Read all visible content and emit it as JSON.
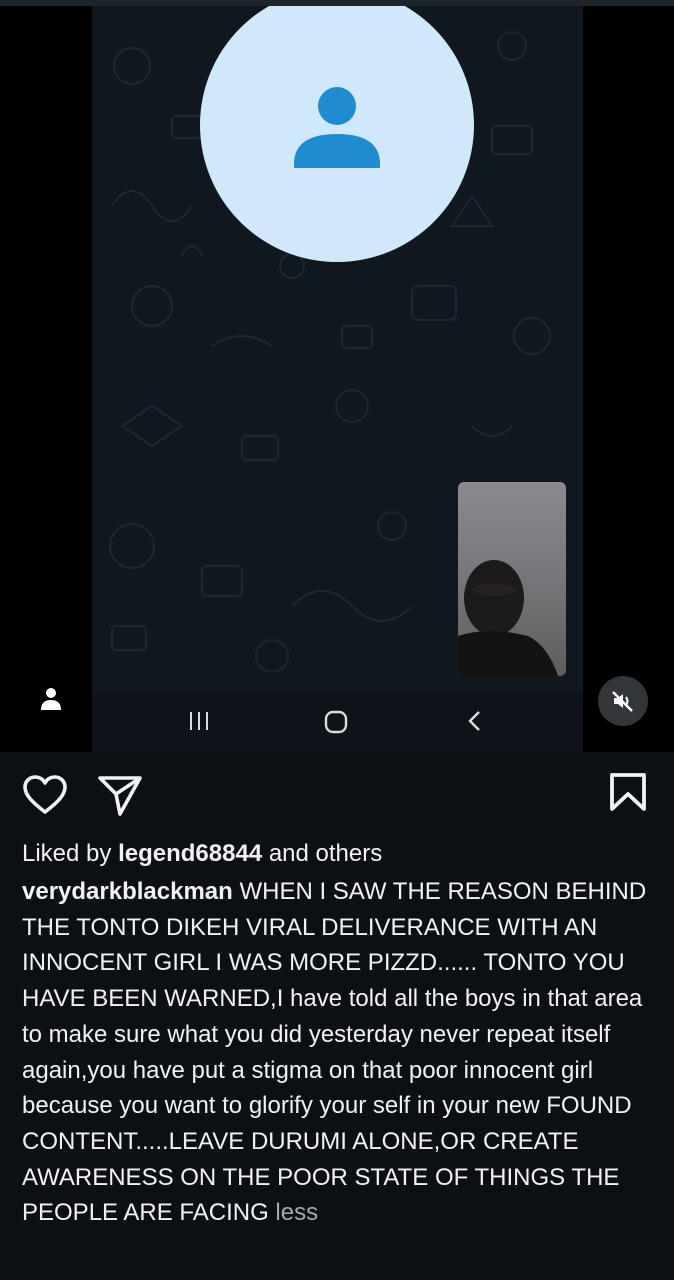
{
  "video": {
    "remote_avatar_icon": "person-icon",
    "self_view_label": "self-view camera preview",
    "nav_buttons": [
      "recent-apps-icon",
      "home-icon",
      "back-icon"
    ],
    "user_tag_icon": "person-icon",
    "mute_icon": "speaker-muted-icon"
  },
  "post": {
    "actions": {
      "like_icon": "heart-icon",
      "share_icon": "send-icon",
      "save_icon": "bookmark-icon"
    },
    "likes": {
      "prefix": "Liked by ",
      "user": "legend68844",
      "suffix": " and others"
    },
    "caption": {
      "username": "verydarkblackman",
      "text": " WHEN I SAW THE REASON BEHIND THE TONTO DIKEH VIRAL DELIVERANCE WITH AN INNOCENT GIRL I WAS MORE PIZZD...... TONTO YOU HAVE BEEN WARNED,I have told all the boys in that area to make sure what you did yesterday never repeat itself again,you have put a stigma on that poor innocent girl because you want to glorify your self in your new FOUND CONTENT.....LEAVE DURUMI ALONE,OR CREATE AWARENESS ON THE POOR STATE OF THINGS THE PEOPLE ARE FACING ",
      "less_label": "less"
    }
  }
}
